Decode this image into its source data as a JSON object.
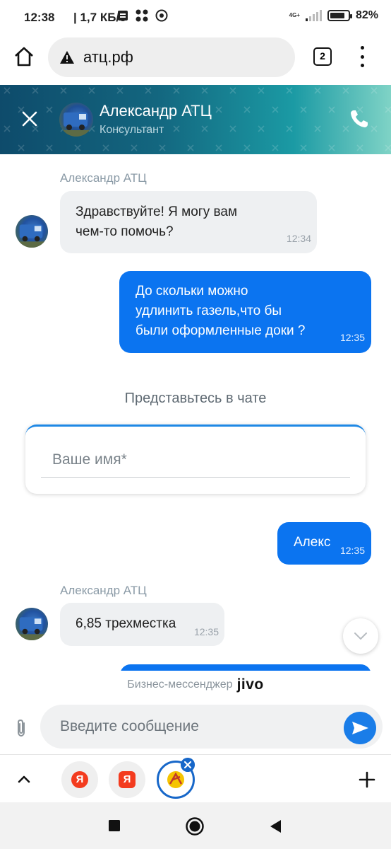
{
  "status_bar": {
    "time": "12:38",
    "network_speed": "| 1,7 КБ/с",
    "icons": [
      "sim-card-icon",
      "dots-icon",
      "shield-icon"
    ],
    "network_type": "4G+",
    "battery_percent": "82%",
    "battery_level": 0.82
  },
  "browser": {
    "url": "атц.рф",
    "tab_count": "2",
    "security_icon": "warning-icon"
  },
  "chat_header": {
    "agent_name": "Александр АТЦ",
    "agent_role": "Консультант",
    "colors": {
      "start": "#0e4b6b",
      "end": "#7fd3c6"
    }
  },
  "messages": [
    {
      "direction": "in",
      "sender": "Александр АТЦ",
      "text": "Здравствуйте! Я могу вам\nчем-то помочь?",
      "time": "12:34"
    },
    {
      "direction": "out",
      "text": "До скольки можно\nудлинить газель,что бы\nбыли оформленные доки ?",
      "time": "12:35"
    },
    {
      "direction": "out",
      "text": "Алекс",
      "time": "12:35"
    },
    {
      "direction": "in",
      "sender": "Александр АТЦ",
      "text": "6,85 трехместка",
      "time": "12:35"
    }
  ],
  "intro_form": {
    "title": "Представьтесь в чате",
    "name_placeholder": "Ваше имя*"
  },
  "powered_by": {
    "label": "Бизнес-мессенджер",
    "brand": "jivo"
  },
  "composer": {
    "placeholder": "Введите сообщение",
    "accent_color": "#1a7de8"
  },
  "tab_strip": {
    "tabs": [
      {
        "icon": "yandex-icon",
        "letter": "Я"
      },
      {
        "icon": "yandex-square-icon",
        "letter": "Я"
      },
      {
        "icon": "site-favicon-icon",
        "active": true
      }
    ]
  },
  "nav_bar": {
    "buttons": [
      "recent-apps-icon",
      "home-icon",
      "back-icon"
    ]
  }
}
